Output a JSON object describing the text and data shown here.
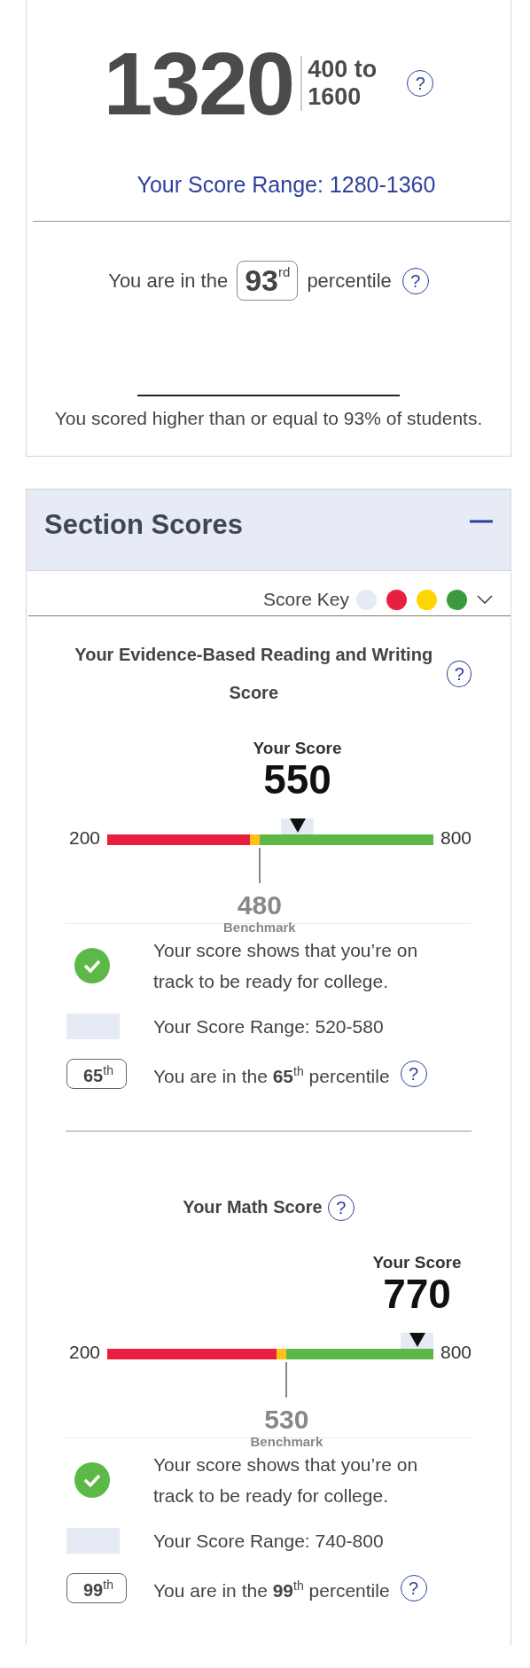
{
  "total": {
    "score": "1320",
    "scale": "400 to 1600",
    "help": "?",
    "range": "Your Score Range: 1280-1360"
  },
  "percentile": {
    "prefix": "You are in the",
    "badge": "93$^{rd}$",
    "suffix": "percentile",
    "help": "?",
    "note": "You scored higher than or equal to 93% of students."
  },
  "section_scores": {
    "title": "Section Scores",
    "expanded": true,
    "score_key": {
      "label": "Score Key",
      "dots": [
        {
          "color": "#e5eaf5"
        },
        {
          "color": "#e8203f"
        },
        {
          "color": "#ffd600"
        },
        {
          "color": "#3a9a3c"
        }
      ]
    },
    "sections": [
      {
        "title": "Your Evidence-Based Reading and Writing Score",
        "help": "?",
        "your_score_label": "Your Score",
        "score": "550",
        "min": "200",
        "max": "800",
        "marker": {
          "level": 0.583
        },
        "benchmark_marker": {
          "level": 0.467
        },
        "benchmark": "480",
        "benchmark_label": "Benchmark",
        "status": "Your score shows that you’re on track to be ready for college.",
        "on_track": true,
        "range": "Your Score Range: 520-580",
        "percentile_badge": "65$^{th}$",
        "percentile_text": "You are in the **65**$^{th}$ percentile",
        "percentile_help": "?"
      },
      {
        "title": "Your Math Score",
        "help": "?",
        "your_score_label": "Your Score",
        "score": "770",
        "min": "200",
        "max": "800",
        "marker": {
          "level": 0.95
        },
        "benchmark_marker": {
          "level": 0.55
        },
        "benchmark": "530",
        "benchmark_label": "Benchmark",
        "status": "Your score shows that you’re on track to be ready for college.",
        "on_track": true,
        "range": "Your Score Range: 740-800",
        "percentile_badge": "99$^{th}$",
        "percentile_text": "You are in the **99**$^{th}$ percentile",
        "percentile_help": "?"
      }
    ]
  }
}
